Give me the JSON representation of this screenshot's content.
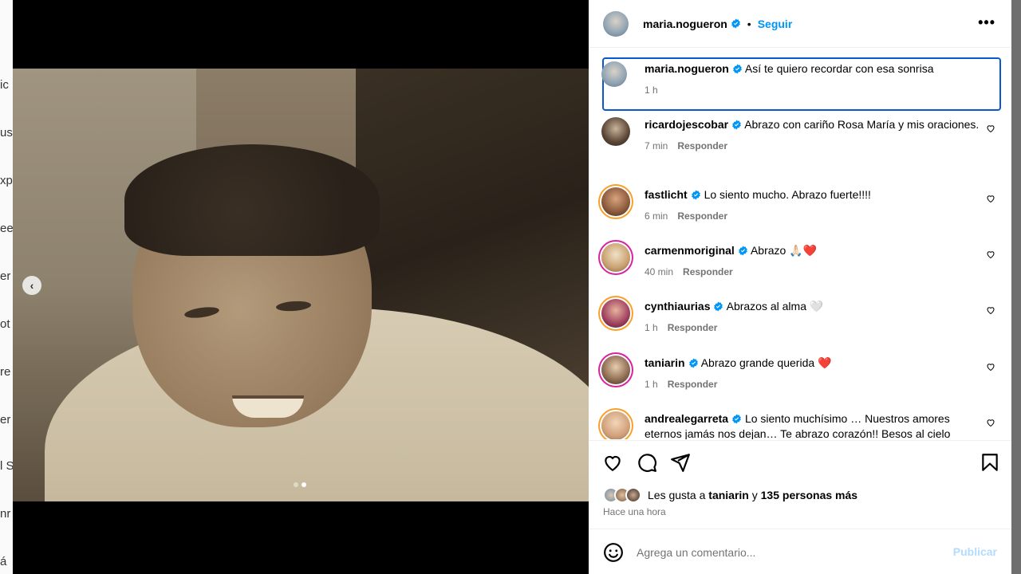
{
  "background_page": {
    "fragments": [
      "ic",
      "us",
      "xp",
      "ee",
      "er",
      "ot",
      "re",
      "er",
      "l S",
      "nr",
      "á"
    ]
  },
  "post": {
    "author": "maria.nogueron",
    "separator": "•",
    "follow_label": "Seguir",
    "more_label": "•••",
    "carousel_prev": "‹",
    "carousel_total": 2,
    "carousel_active": 2
  },
  "caption": {
    "username": "maria.nogueron",
    "text": "Así te quiero recordar con esa sonrisa",
    "time": "1 h"
  },
  "comments": [
    {
      "username": "ricardojescobar",
      "text": "Abrazo con cariño Rosa María y mis oraciones.",
      "time": "7 min",
      "reply": "Responder"
    },
    {
      "username": "fastlicht",
      "text": "Lo siento mucho. Abrazo fuerte!!!!",
      "time": "6 min",
      "reply": "Responder"
    },
    {
      "username": "carmenmoriginal",
      "text": "Abrazo 🙏🏻❤️",
      "time": "40 min",
      "reply": "Responder"
    },
    {
      "username": "cynthiaurias",
      "text": "Abrazos al alma 🤍",
      "time": "1 h",
      "reply": "Responder"
    },
    {
      "username": "taniarin",
      "text": "Abrazo grande querida ❤️",
      "time": "1 h",
      "reply": "Responder"
    },
    {
      "username": "andrealegarreta",
      "text": "Lo siento muchísimo … Nuestros amores eternos jamás nos dejan… Te abrazo corazón!! Besos al cielo",
      "time": "",
      "reply": ""
    }
  ],
  "likes": {
    "prefix": "Les gusta a",
    "user": "taniarin",
    "connector": "y",
    "others": "135 personas más"
  },
  "posted_ago": "Hace una hora",
  "composer": {
    "placeholder": "Agrega un comentario...",
    "publish_label": "Publicar"
  },
  "colors": {
    "accent": "#0095f6",
    "verified": "#0095f6",
    "publish_disabled": "#b3dbff",
    "caption_focus": "#0a58d0"
  },
  "icons": [
    "heart-icon",
    "comment-icon",
    "share-icon",
    "bookmark-icon",
    "emoji-icon",
    "verified-icon",
    "more-icon",
    "chevron-left-icon"
  ]
}
